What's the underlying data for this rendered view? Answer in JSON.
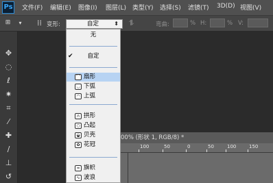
{
  "app": {
    "logo": "Ps"
  },
  "menu": [
    "文件(F)",
    "编辑(E)",
    "图像(I)",
    "图层(L)",
    "类型(Y)",
    "选择(S)",
    "滤镜(T)",
    "3D(D)",
    "视图(V)"
  ],
  "options": {
    "warp_label": "变形:",
    "warp_value": "自定",
    "bend_label": "弯曲:",
    "bend_unit": "%",
    "h_label": "H:",
    "h_unit": "%",
    "v_label": "V:"
  },
  "warp_menu": {
    "items": [
      {
        "label": "无",
        "checked": false,
        "icon": ""
      },
      {
        "label": "自定",
        "checked": true,
        "icon": ""
      },
      {
        "label": "扇形",
        "checked": false,
        "icon": "arc-icon",
        "highlighted": true
      },
      {
        "label": "下弧",
        "checked": false,
        "icon": "arc-lower-icon"
      },
      {
        "label": "上弧",
        "checked": false,
        "icon": "arc-upper-icon"
      },
      {
        "label": "拱形",
        "checked": false,
        "icon": "arch-icon"
      },
      {
        "label": "凸起",
        "checked": false,
        "icon": "bulge-icon"
      },
      {
        "label": "贝壳",
        "checked": false,
        "icon": "shell-icon"
      },
      {
        "label": "花冠",
        "checked": false,
        "icon": "flower-icon"
      },
      {
        "label": "旗帜",
        "checked": false,
        "icon": "flag-icon"
      },
      {
        "label": "波浪",
        "checked": false,
        "icon": "wave-icon"
      }
    ]
  },
  "document": {
    "tab_title": "00% (形状 1, RGB/8) *",
    "ruler_labels": [
      "100",
      "50",
      "0",
      "50",
      "100",
      "150"
    ]
  },
  "colors": {
    "menubar": "#505050",
    "options": "#454545",
    "toolbox": "#3a3a3a",
    "canvas": "#6b6b6b",
    "highlight": "#b7d3f3"
  }
}
